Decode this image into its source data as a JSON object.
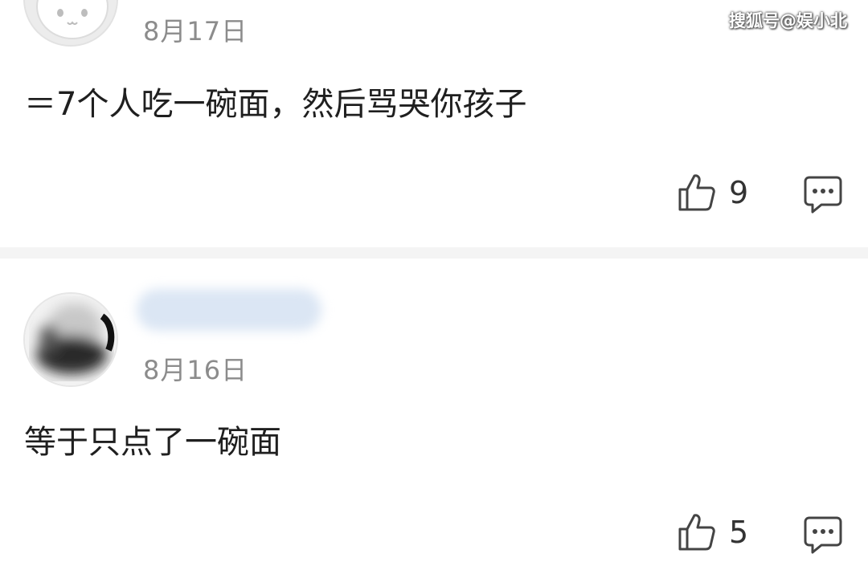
{
  "watermark": "搜狐号@娱小北",
  "comments": [
    {
      "date": "8月17日",
      "text": "＝7个人吃一碗面，然后骂哭你孩子",
      "likes": "9",
      "avatar_icon": "cartoon-face-avatar"
    },
    {
      "date": "8月16日",
      "text": "等于只点了一碗面",
      "likes": "5",
      "avatar_icon": "blurred-avatar"
    }
  ],
  "icons": {
    "like": "thumbs-up-icon",
    "reply": "comment-bubble-icon"
  },
  "colors": {
    "text": "#1f1f1f",
    "meta": "#8c8c8c",
    "separator": "#f4f4f4"
  }
}
